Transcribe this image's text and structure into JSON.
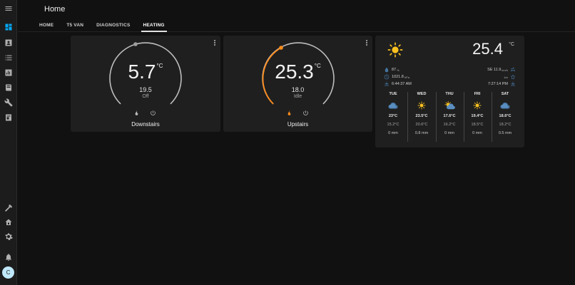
{
  "header": {
    "title": "Home",
    "tabs": [
      {
        "label": "HOME"
      },
      {
        "label": "T5 VAN"
      },
      {
        "label": "DIAGNOSTICS"
      },
      {
        "label": "HEATING"
      }
    ]
  },
  "sidebar": {
    "icons": [
      "menu-icon",
      "dashboard-icon",
      "account-box-icon",
      "list-icon",
      "chart-box-icon",
      "book-icon",
      "wrench-icon",
      "calendar-icon",
      "hammer-icon",
      "home-settings-icon",
      "cog-icon",
      "bell-icon"
    ],
    "user_initial": "C"
  },
  "thermostats": [
    {
      "current": "5.7",
      "unit": "°C",
      "target": "19.5",
      "state": "Off",
      "name": "Downstairs",
      "accent": "#9e9e9e"
    },
    {
      "current": "25.3",
      "unit": "°C",
      "target": "18.0",
      "state": "Idle",
      "name": "Upstairs",
      "accent": "#ff8c1a"
    }
  ],
  "weather": {
    "condition_icon": "sunny-icon",
    "temperature": "25.4",
    "unit": "°C",
    "humidity": "87",
    "humidity_unit": "%",
    "pressure": "1021.8",
    "pressure_unit": "hPa",
    "sunrise": "6:44:37 AM",
    "wind": "SE 11.9",
    "wind_unit": "km/h",
    "visibility_unit": "km",
    "sunset": "7:27:14 PM",
    "forecast": [
      {
        "day": "TUE",
        "icon": "partly-cloudy-icon",
        "high": "23°C",
        "low": "15.2°C",
        "precip": "0 mm"
      },
      {
        "day": "WED",
        "icon": "sunny-icon",
        "high": "23.5°C",
        "low": "20.6°C",
        "precip": "0.8 mm"
      },
      {
        "day": "THU",
        "icon": "partly-sunny-icon",
        "high": "17.6°C",
        "low": "16.2°C",
        "precip": "0 mm"
      },
      {
        "day": "FRI",
        "icon": "sunny-icon",
        "high": "19.4°C",
        "low": "18.5°C",
        "precip": "0 mm"
      },
      {
        "day": "SAT",
        "icon": "partly-cloudy-icon",
        "high": "18.6°C",
        "low": "18.2°C",
        "precip": "0.5 mm"
      }
    ]
  }
}
